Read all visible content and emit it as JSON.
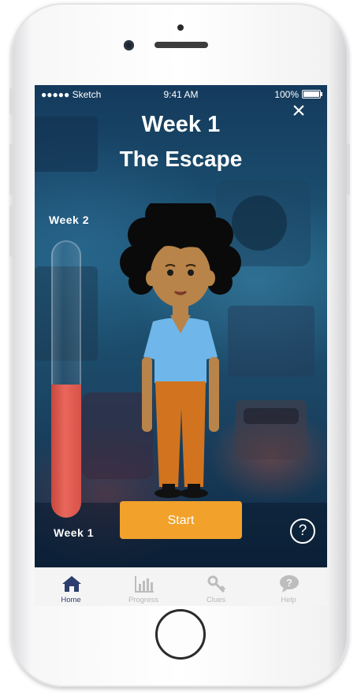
{
  "status_bar": {
    "carrier": "●●●●● Sketch",
    "time": "9:41 AM",
    "battery": "100%"
  },
  "header": {
    "week_title": "Week 1",
    "episode_title": "The Escape",
    "close_icon": "close-icon"
  },
  "progress_tube": {
    "top_label": "Week 2",
    "bottom_label": "Week 1",
    "fill_fraction": 0.48,
    "fill_color": "#e05a50"
  },
  "start_button": {
    "label": "Start",
    "color": "#f2a12b"
  },
  "help_button": {
    "icon": "question-icon",
    "glyph": "?"
  },
  "tab_bar": {
    "tabs": [
      {
        "label": "Home",
        "icon": "home-icon",
        "active": true
      },
      {
        "label": "Progress",
        "icon": "bar-chart-icon",
        "active": false
      },
      {
        "label": "Clues",
        "icon": "key-icon",
        "active": false
      },
      {
        "label": "Help",
        "icon": "speech-bubble-question-icon",
        "active": false
      }
    ],
    "active_color": "#2c3e6d",
    "inactive_color": "#b8b8b8"
  }
}
